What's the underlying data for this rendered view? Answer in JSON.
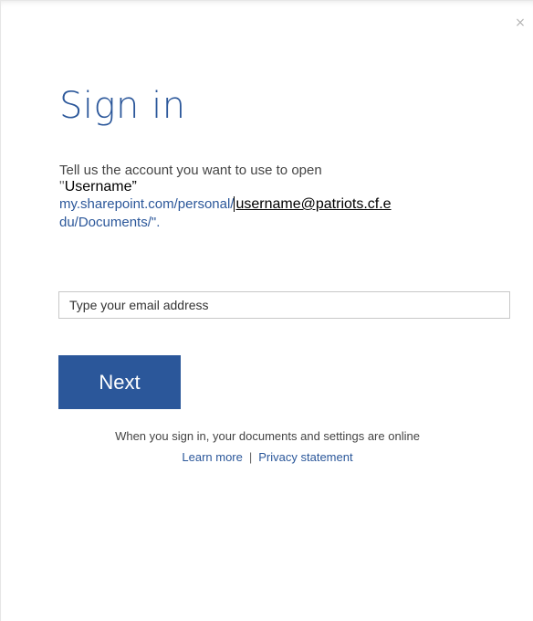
{
  "dialog": {
    "close_label": "×",
    "title": "Sign in",
    "description": {
      "line1": "Tell us the account you want to use to open",
      "doc_open_quote": "\"",
      "doc_name": "Username”",
      "url_prefix": "my.sharepoint.com/personal/",
      "url_user": "username@patriots.cf.e",
      "url_suffix": "du/Documents/\"."
    },
    "email_placeholder": "Type your email address",
    "next_label": "Next",
    "footer": {
      "info": "When you sign in, your documents and settings are online",
      "learn_more": "Learn more",
      "separator": "|",
      "privacy": "Privacy statement"
    }
  },
  "colors": {
    "accent": "#2b579a",
    "text": "#444444",
    "border": "#c8c8c8"
  }
}
